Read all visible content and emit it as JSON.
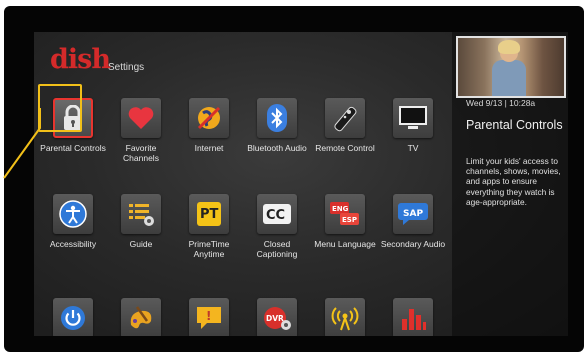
{
  "header": {
    "logo": "dish",
    "section": "Settings"
  },
  "tiles": [
    {
      "label": "Parental Controls",
      "icon": "lock-icon"
    },
    {
      "label": "Favorite Channels",
      "icon": "heart-icon"
    },
    {
      "label": "Internet",
      "icon": "globe-icon"
    },
    {
      "label": "Bluetooth Audio",
      "icon": "bluetooth-icon"
    },
    {
      "label": "Remote Control",
      "icon": "remote-icon"
    },
    {
      "label": "TV",
      "icon": "tv-icon"
    },
    {
      "label": "Accessibility",
      "icon": "accessibility-icon"
    },
    {
      "label": "Guide",
      "icon": "guide-list-icon"
    },
    {
      "label": "PrimeTime Anytime",
      "icon": "primetime-icon",
      "badge": "PT"
    },
    {
      "label": "Closed Captioning",
      "icon": "cc-icon",
      "badge": "CC"
    },
    {
      "label": "Menu Language",
      "icon": "language-icon",
      "badge_a": "ENG",
      "badge_b": "ESP"
    },
    {
      "label": "Secondary Audio",
      "icon": "sap-icon",
      "badge": "SAP"
    },
    {
      "label": "",
      "icon": "power-icon"
    },
    {
      "label": "",
      "icon": "palette-icon"
    },
    {
      "label": "",
      "icon": "alert-icon",
      "badge": "!"
    },
    {
      "label": "",
      "icon": "dvr-icon",
      "badge": "DVR"
    },
    {
      "label": "",
      "icon": "signal-icon"
    },
    {
      "label": "",
      "icon": "equalizer-icon"
    }
  ],
  "panel": {
    "datetime": "Wed 9/13 | 10:28a",
    "title": "Parental Controls",
    "description": "Limit your kids' access to channels, shows, movies, and apps to ensure everything they watch is age-appropriate."
  },
  "colors": {
    "brand": "#d42a2a",
    "callout": "#f2c019",
    "selection": "#e8352f"
  }
}
